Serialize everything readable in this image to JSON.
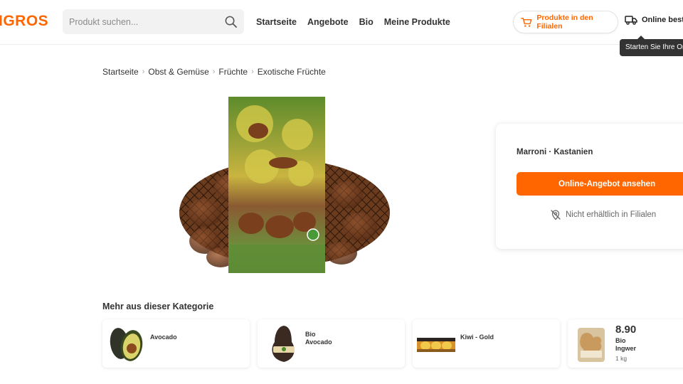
{
  "header": {
    "logo_text": "IGROS",
    "brand_color": "#ff6600",
    "search_placeholder": "Produkt suchen...",
    "nav": [
      "Startseite",
      "Angebote",
      "Bio",
      "Meine Produkte"
    ],
    "store_button_label": "Produkte in den Filialen",
    "online_button_label": "Online beste",
    "tooltip_text": "Starten Sie Ihre On"
  },
  "breadcrumb": [
    "Startseite",
    "Obst & Gemüse",
    "Früchte",
    "Exotische Früchte"
  ],
  "product": {
    "name": "Marroni · Kastanien",
    "cta_label": "Online-Angebot ansehen",
    "availability": "Nicht erhältlich in Filialen"
  },
  "related": {
    "title": "Mehr aus dieser Kategorie",
    "items": [
      {
        "name_lines": [
          "Avocado"
        ],
        "price": "",
        "qty": "",
        "icon": "avocado-image"
      },
      {
        "name_lines": [
          "Bio",
          "Avocado"
        ],
        "price": "",
        "qty": "",
        "icon": "bio-avocado-image"
      },
      {
        "name_lines": [
          "Kiwi - Gold"
        ],
        "price": "",
        "qty": "",
        "icon": "kiwi-gold-image"
      },
      {
        "name_lines": [
          "Bio",
          "Ingwer"
        ],
        "price": "8.90",
        "qty": "1 kg",
        "icon": "ginger-image"
      }
    ]
  }
}
